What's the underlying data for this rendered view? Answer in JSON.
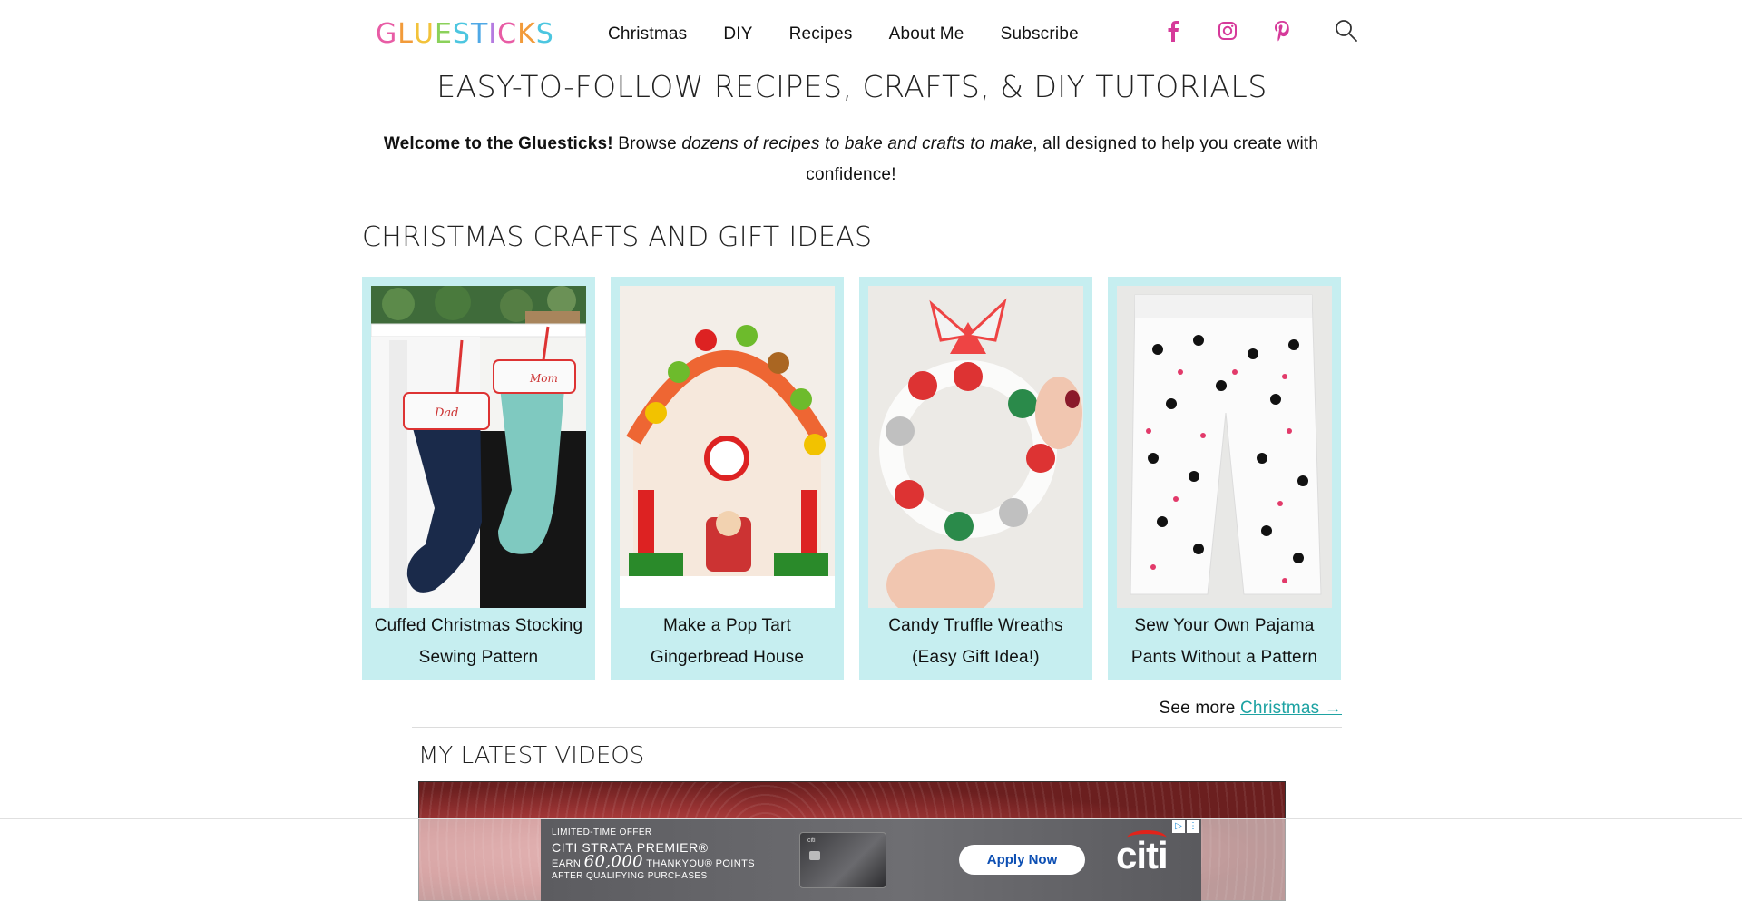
{
  "header": {
    "logo_letters": [
      "G",
      "L",
      "U",
      "E",
      "S",
      "T",
      "I",
      "C",
      "K",
      "S"
    ],
    "logo_colors": [
      "#e85ca5",
      "#f29b3a",
      "#f2c23a",
      "#8bd15a",
      "#4cc6e0",
      "#4fa8e6",
      "#b57be0",
      "#e85ca5",
      "#f29b3a",
      "#4cc6e0"
    ],
    "nav": [
      "Christmas",
      "DIY",
      "Recipes",
      "About Me",
      "Subscribe"
    ],
    "social_icons": [
      "facebook-icon",
      "instagram-icon",
      "pinterest-icon"
    ],
    "accent_color": "#d63a9a"
  },
  "page": {
    "title": "EASY-TO-FOLLOW RECIPES, CRAFTS, & DIY TUTORIALS",
    "welcome_bold": "Welcome to the Gluesticks!",
    "welcome_browse": " Browse ",
    "welcome_italic": "dozens of recipes to bake and crafts to make",
    "welcome_rest": ", all designed to help you create with confidence!"
  },
  "christmas": {
    "heading": "CHRISTMAS CRAFTS AND GIFT IDEAS",
    "cards": [
      {
        "title": "Cuffed Christmas Stocking Sewing Pattern"
      },
      {
        "title": "Make a Pop Tart Gingerbread House"
      },
      {
        "title": "Candy Truffle Wreaths (Easy Gift Idea!)"
      },
      {
        "title": "Sew Your Own Pajama Pants Without a Pattern"
      }
    ],
    "see_more_text": "See more ",
    "see_more_link": "Christmas →",
    "card_bg": "#c6eef0",
    "link_color": "#1ea3a3"
  },
  "videos": {
    "heading": "MY LATEST VIDEOS"
  },
  "ad": {
    "line1": "LIMITED-TIME OFFER",
    "line2": "CITI STRATA PREMIER®",
    "earn": "EARN",
    "points_num": "60,000",
    "points_text": "THANKYOU® POINTS",
    "line4": "AFTER QUALIFYING PURCHASES",
    "card_label": "citi",
    "button": "Apply Now",
    "brand": "citi"
  }
}
